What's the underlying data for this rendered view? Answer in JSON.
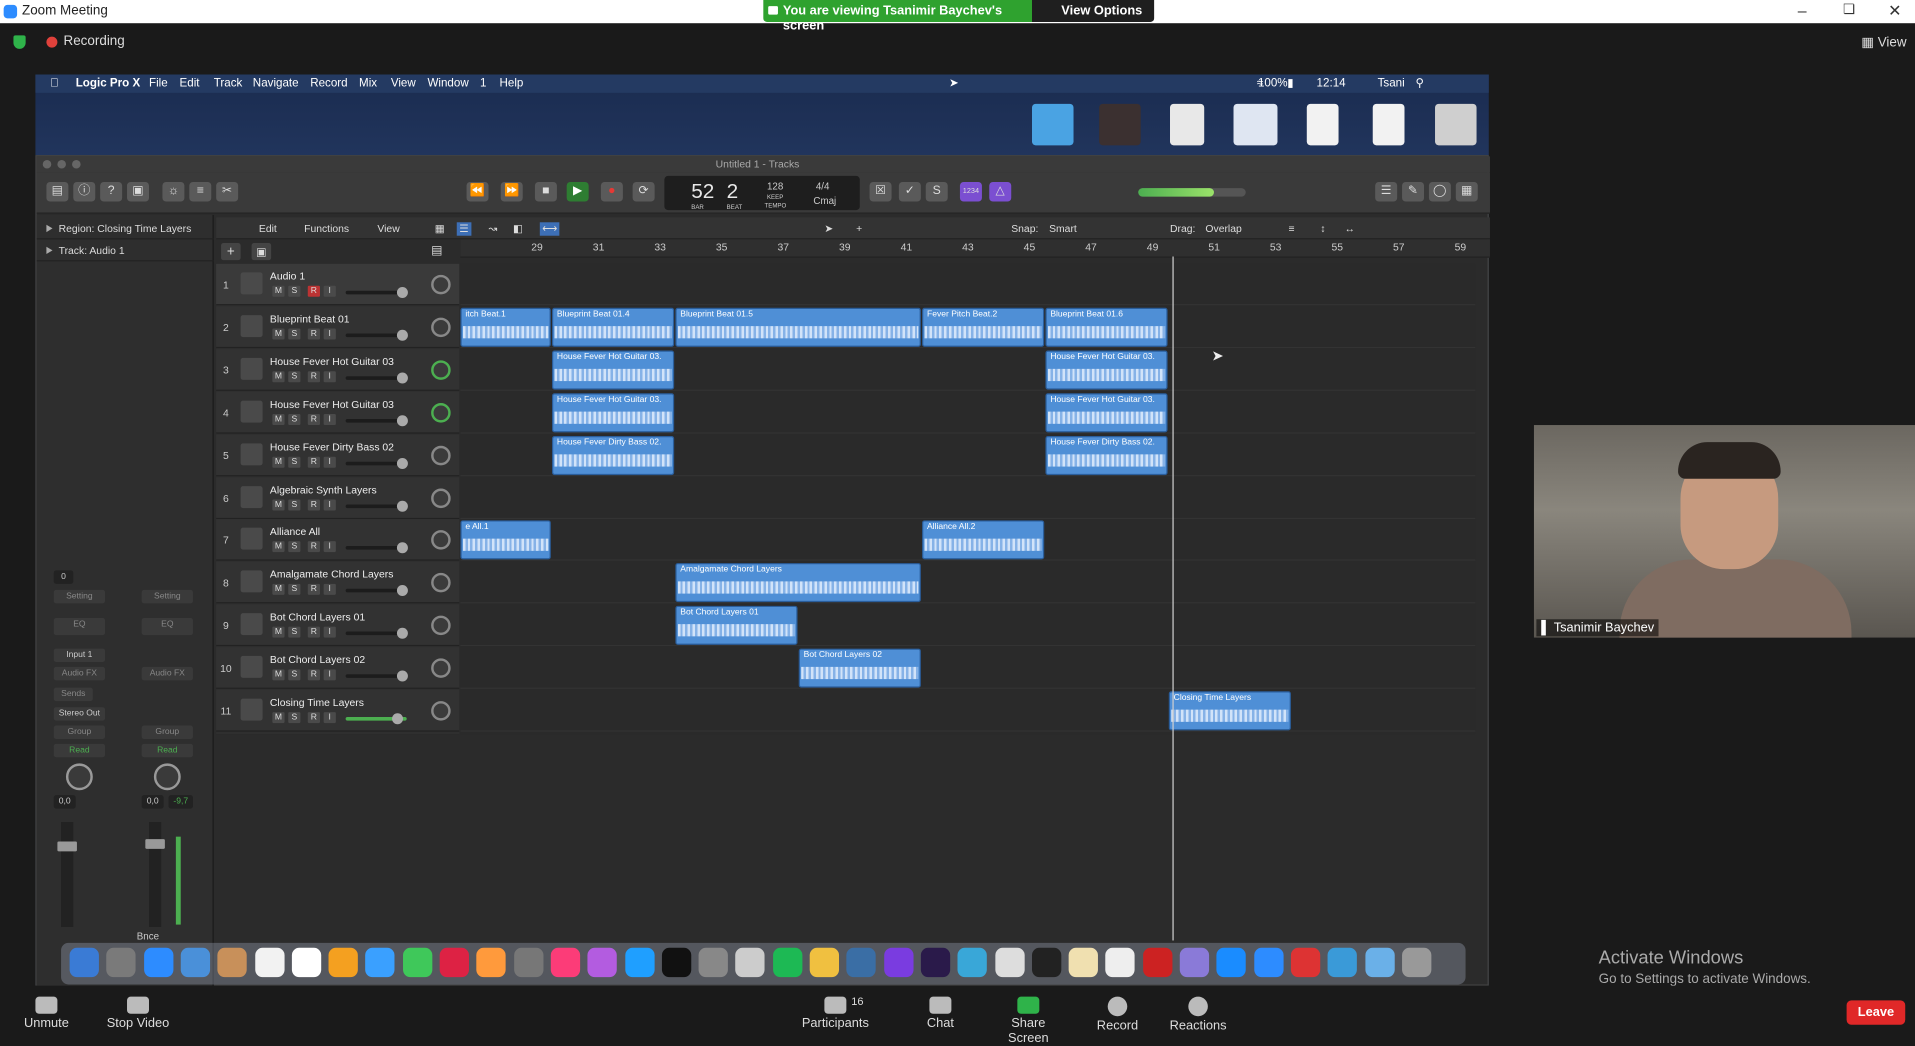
{
  "zoom": {
    "title": "Zoom Meeting",
    "banner": "You are viewing Tsanimir Baychev's screen",
    "view_options": "View Options",
    "recording": "Recording",
    "view": "View",
    "participant_name": "Tsanimir Baychev",
    "participants_count": "16",
    "bottom": [
      {
        "label": "Unmute"
      },
      {
        "label": "Stop Video"
      },
      {
        "label": "Participants"
      },
      {
        "label": "Chat"
      },
      {
        "label": "Share Screen"
      },
      {
        "label": "Record"
      },
      {
        "label": "Reactions"
      }
    ],
    "leave": "Leave",
    "activate_title": "Activate Windows",
    "activate_sub": "Go to Settings to activate Windows."
  },
  "mac": {
    "menu": [
      "Logic Pro X",
      "File",
      "Edit",
      "Track",
      "Navigate",
      "Record",
      "Mix",
      "View",
      "Window",
      "1",
      "Help"
    ],
    "status": {
      "battery": "100%",
      "time": "12:14",
      "user": "Tsani"
    }
  },
  "logic": {
    "window_title": "Untitled 1 - Tracks",
    "lcd": {
      "bar": "52",
      "beat": "2",
      "bar_label": "BAR",
      "beat_label": "BEAT",
      "tempo": "128",
      "keep": "KEEP",
      "tempo_label": "TEMPO",
      "sig": "4/4",
      "key": "Cmaj"
    },
    "inspector": {
      "region": "Region: Closing Time Layers",
      "track": "Track:  Audio 1",
      "setting": "Setting",
      "eq": "EQ",
      "input": "Input 1",
      "audio_fx": "Audio FX",
      "sends": "Sends",
      "stereo_out": "Stereo Out",
      "group": "Group",
      "read": "Read",
      "val_a": "0,0",
      "val_b": "0,0",
      "val_c": "-9,7",
      "zero": "0",
      "bnce": "Bnce"
    },
    "menus": {
      "edit": "Edit",
      "functions": "Functions",
      "view": "View",
      "snap_label": "Snap:",
      "snap": "Smart",
      "drag_label": "Drag:",
      "drag": "Overlap"
    },
    "ruler": [
      "29",
      "31",
      "33",
      "35",
      "37",
      "39",
      "41",
      "43",
      "45",
      "47",
      "49",
      "51",
      "53",
      "55",
      "57",
      "59"
    ],
    "buttons": {
      "m": "M",
      "s": "S",
      "r": "R",
      "i": "I"
    },
    "tracks": [
      {
        "num": "1",
        "name": "Audio 1"
      },
      {
        "num": "2",
        "name": "Blueprint Beat 01"
      },
      {
        "num": "3",
        "name": "House Fever Hot Guitar 03"
      },
      {
        "num": "4",
        "name": "House Fever Hot Guitar 03"
      },
      {
        "num": "5",
        "name": "House Fever Dirty Bass 02"
      },
      {
        "num": "6",
        "name": "Algebraic Synth Layers"
      },
      {
        "num": "7",
        "name": "Alliance All"
      },
      {
        "num": "8",
        "name": "Amalgamate Chord Layers"
      },
      {
        "num": "9",
        "name": "Bot Chord Layers 01"
      },
      {
        "num": "10",
        "name": "Bot Chord Layers 02"
      },
      {
        "num": "11",
        "name": "Closing Time Layers"
      }
    ],
    "regions": [
      {
        "lane": 1,
        "start": 0,
        "width": 74,
        "name": "itch Beat.1"
      },
      {
        "lane": 1,
        "start": 75,
        "width": 100,
        "name": "Blueprint Beat 01.4"
      },
      {
        "lane": 1,
        "start": 176,
        "width": 201,
        "name": "Blueprint Beat 01.5"
      },
      {
        "lane": 1,
        "start": 378,
        "width": 100,
        "name": "Fever Pitch Beat.2"
      },
      {
        "lane": 1,
        "start": 479,
        "width": 100,
        "name": "Blueprint Beat 01.6"
      },
      {
        "lane": 2,
        "start": 75,
        "width": 100,
        "name": "House Fever Hot Guitar 03."
      },
      {
        "lane": 2,
        "start": 479,
        "width": 100,
        "name": "House Fever Hot Guitar 03."
      },
      {
        "lane": 3,
        "start": 75,
        "width": 100,
        "name": "House Fever Hot Guitar 03."
      },
      {
        "lane": 3,
        "start": 479,
        "width": 100,
        "name": "House Fever Hot Guitar 03."
      },
      {
        "lane": 4,
        "start": 75,
        "width": 100,
        "name": "House Fever Dirty Bass 02."
      },
      {
        "lane": 4,
        "start": 479,
        "width": 100,
        "name": "House Fever Dirty Bass 02."
      },
      {
        "lane": 6,
        "start": 0,
        "width": 74,
        "name": "e All.1"
      },
      {
        "lane": 6,
        "start": 378,
        "width": 100,
        "name": "Alliance All.2"
      },
      {
        "lane": 7,
        "start": 176,
        "width": 201,
        "name": "Amalgamate Chord Layers"
      },
      {
        "lane": 8,
        "start": 176,
        "width": 100,
        "name": "Bot Chord Layers 01"
      },
      {
        "lane": 9,
        "start": 277,
        "width": 100,
        "name": "Bot Chord Layers 02"
      },
      {
        "lane": 10,
        "start": 580,
        "width": 100,
        "name": "Closing Time Layers"
      }
    ]
  }
}
